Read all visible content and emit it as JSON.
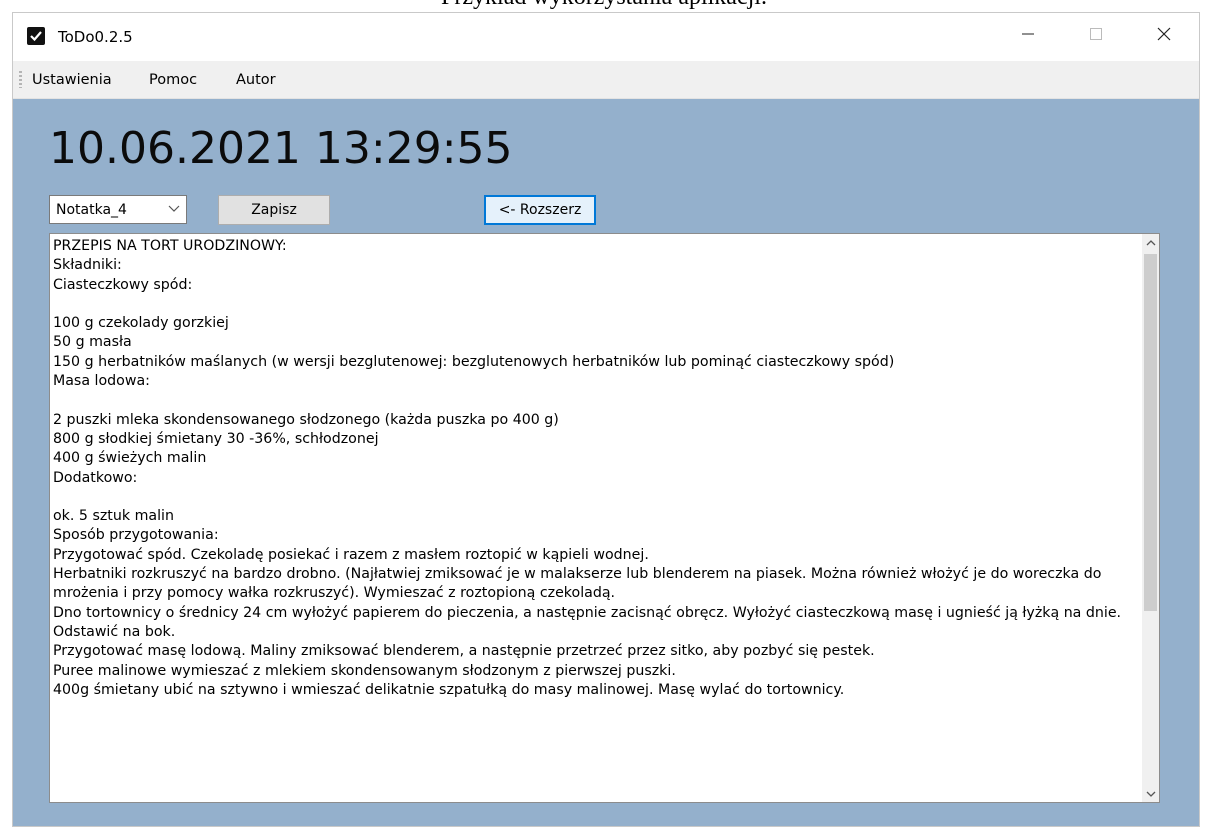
{
  "doc_caption": "Przykład wykorzystania aplikacji.",
  "window": {
    "title": "ToDo0.2.5"
  },
  "menu": {
    "items": [
      "Ustawienia",
      "Pomoc",
      "Autor"
    ]
  },
  "clock": "10.06.2021 13:29:55",
  "note_select": {
    "selected": "Notatka_4"
  },
  "buttons": {
    "save": "Zapisz",
    "expand": "<- Rozszerz"
  },
  "note_text": "PRZEPIS NA TORT URODZINOWY:\nSkładniki:\nCiasteczkowy spód:\n\n100 g czekolady gorzkiej\n50 g masła\n150 g herbatników maślanych (w wersji bezglutenowej: bezglutenowych herbatników lub pominąć ciasteczkowy spód)\nMasa lodowa:\n\n2 puszki mleka skondensowanego słodzonego (każda puszka po 400 g)\n800 g słodkiej śmietany 30 -36%, schłodzonej\n400 g świeżych malin\nDodatkowo:\n\nok. 5 sztuk malin\nSposób przygotowania:\nPrzygotować spód. Czekoladę posiekać i razem z masłem roztopić w kąpieli wodnej.\nHerbatniki rozkruszyć na bardzo drobno. (Najłatwiej zmiksować je w malakserze lub blenderem na piasek. Można również włożyć je do woreczka do mrożenia i przy pomocy wałka rozkruszyć). Wymieszać z roztopioną czekoladą.\nDno tortownicy o średnicy 24 cm wyłożyć papierem do pieczenia, a następnie zacisnąć obręcz. Wyłożyć ciasteczkową masę i ugnieść ją łyżką na dnie. Odstawić na bok.\nPrzygotować masę lodową. Maliny zmiksować blenderem, a następnie przetrzeć przez sitko, aby pozbyć się pestek.\nPuree malinowe wymieszać z mlekiem skondensowanym słodzonym z pierwszej puszki.\n400g śmietany ubić na sztywno i wmieszać delikatnie szpatułką do masy malinowej. Masę wylać do tortownicy.",
  "colors": {
    "client_bg": "#94b0cc",
    "focus_border": "#0078d7"
  },
  "icons": {
    "app": "checkbox-icon",
    "minimize": "minimize-icon",
    "maximize": "maximize-icon",
    "close": "close-icon"
  }
}
